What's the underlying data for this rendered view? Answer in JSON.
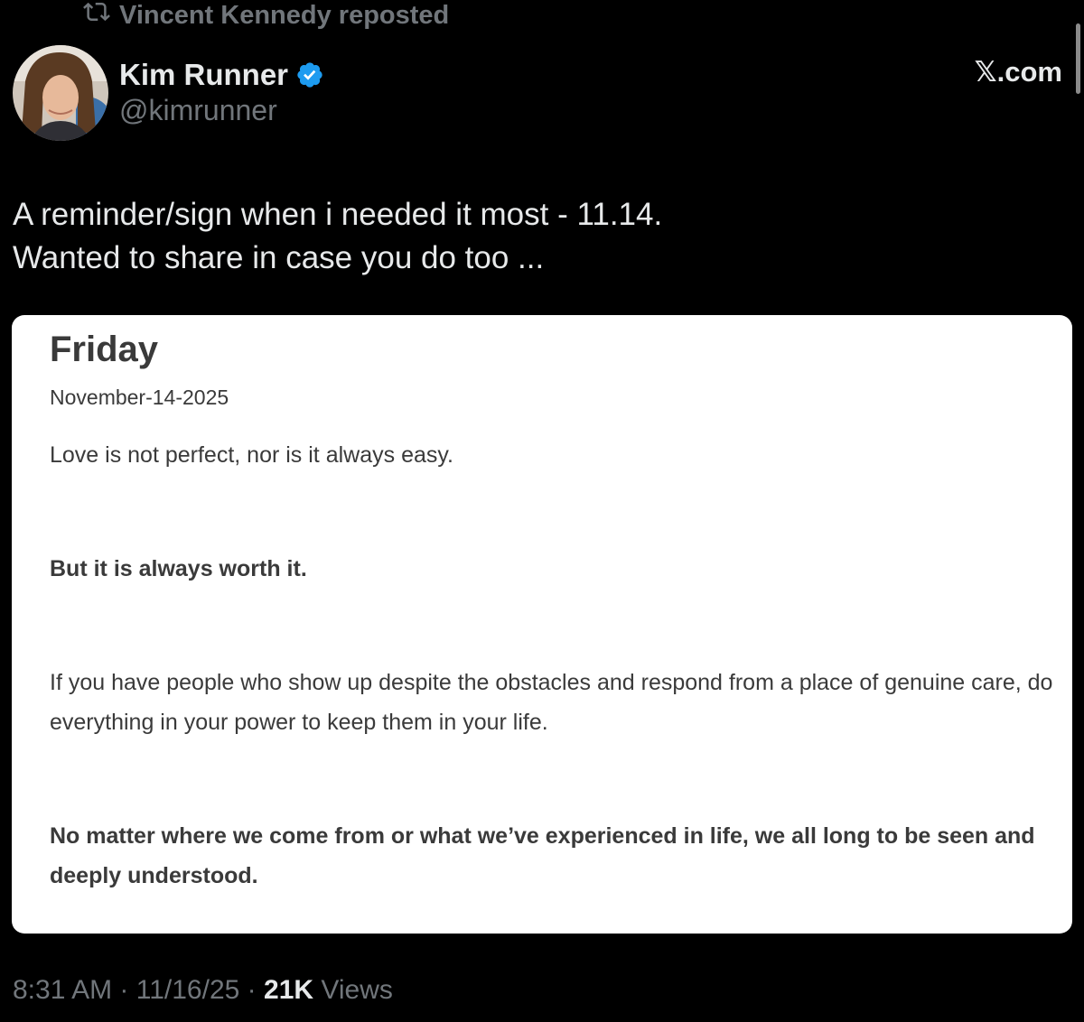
{
  "repost": {
    "label": "Vincent Kennedy reposted",
    "icon": "repost-icon"
  },
  "author": {
    "display_name": "Kim Runner",
    "handle": "@kimrunner",
    "verified": true,
    "verified_color": "#1d9bf0"
  },
  "source_label": "𝕏.com",
  "tweet": {
    "lines": [
      "A reminder/sign when i needed it most - 11.14.",
      "Wanted to share in case you do too ..."
    ]
  },
  "card": {
    "day": "Friday",
    "date": "November-14-2025",
    "paragraphs": [
      "Love is not perfect, nor is it always easy.",
      "But it is always worth it.",
      "If you have people who show up despite the obstacles and respond from a place of genuine care, do everything in your power to keep them in your life.",
      "No matter where we come from or what we’ve experienced in life, we all long to be seen and deeply understood."
    ]
  },
  "meta": {
    "time": "8:31 AM",
    "date": "11/16/25",
    "views_count": "21K",
    "views_label": "Views",
    "separator": "·"
  },
  "colors": {
    "background": "#000000",
    "primary_text": "#e7e9ea",
    "secondary_text": "#71767b",
    "card_background": "#ffffff",
    "card_text": "#3a3a3a"
  }
}
